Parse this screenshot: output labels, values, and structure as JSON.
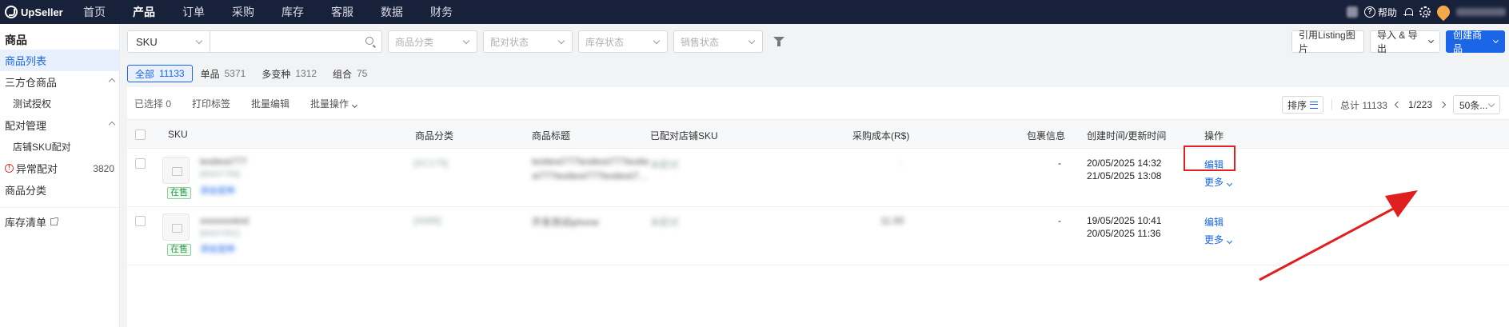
{
  "app": {
    "brand": "UpSeller",
    "nav": [
      "首页",
      "产品",
      "订单",
      "采购",
      "库存",
      "客服",
      "数据",
      "财务"
    ],
    "active_nav": "产品",
    "help_label": "帮助"
  },
  "sidebar": {
    "title": "商品",
    "items": [
      {
        "label": "商品列表"
      },
      {
        "label": "三方仓商品"
      },
      {
        "label": "测试授权"
      },
      {
        "label": "配对管理"
      },
      {
        "label": "店铺SKU配对"
      },
      {
        "label": "异常配对",
        "count": "3820"
      },
      {
        "label": "商品分类"
      },
      {
        "label": "库存清单"
      }
    ]
  },
  "filters": {
    "search_type": "SKU",
    "search_value": "",
    "category": "商品分类",
    "pair_status": "配对状态",
    "stock_status": "库存状态",
    "sale_status": "销售状态"
  },
  "actions": {
    "cite_listing": "引用Listing图片",
    "import_export": "导入 & 导出",
    "create": "创建商品"
  },
  "type_tabs": [
    {
      "label": "全部",
      "count": "11133"
    },
    {
      "label": "单品",
      "count": "5371"
    },
    {
      "label": "多变种",
      "count": "1312"
    },
    {
      "label": "组合",
      "count": "75"
    }
  ],
  "toolbar": {
    "selected": "已选择 0",
    "print": "打印标签",
    "batch_edit": "批量编辑",
    "batch_ops": "批量操作",
    "sort": "排序",
    "total": "总计 11133",
    "page": "1/223",
    "page_size": "50条..."
  },
  "columns": {
    "sku": "SKU",
    "category": "商品分类",
    "title": "商品标题",
    "paired": "已配对店铺SKU",
    "cost": "采购成本(R$)",
    "package": "包裹信息",
    "time": "创建时间/更新时间",
    "ops": "操作"
  },
  "rows": [
    {
      "sku_blur": "testtest777",
      "sku_sub_blur": "[BN/07788]",
      "sku_link_blur": "添加变种",
      "status": "在售",
      "category_blur": "[AC176]",
      "title_blur_1": "testtest777testtest777testte",
      "title_blur_2": "st777testtest777testtest7...",
      "paired_blur": "未配对",
      "cost_blur": "-",
      "package": "-",
      "created": "20/05/2025 14:32",
      "updated": "21/05/2025 13:08",
      "edit": "编辑",
      "more": "更多"
    },
    {
      "sku_blur": "xxxxxxxtest",
      "sku_sub_blur": "[BN/07891]",
      "sku_link_blur": "添加变种",
      "status": "在售",
      "category_blur": "[A888]",
      "title_blur_1": "开发测试iphone",
      "title_blur_2": "",
      "paired_blur": "未配对",
      "cost_blur": "11.00",
      "package": "-",
      "created": "19/05/2025 10:41",
      "updated": "20/05/2025 11:36",
      "edit": "编辑",
      "more": "更多"
    }
  ]
}
